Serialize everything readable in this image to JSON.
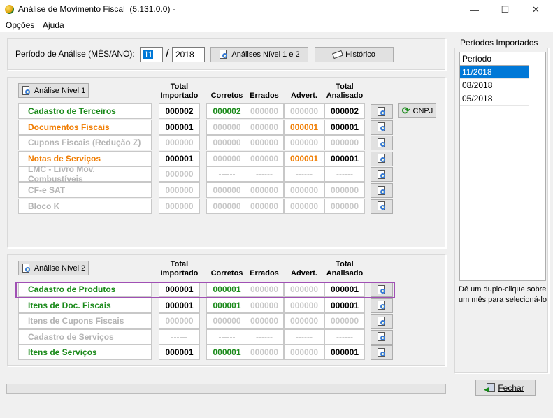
{
  "window": {
    "title": "Análise de Movimento Fiscal",
    "version": "(5.131.0.0) -",
    "minimize": "—",
    "maximize": "☐",
    "close": "✕"
  },
  "menu": {
    "opcoes": "Opções",
    "ajuda": "Ajuda"
  },
  "periodo": {
    "label": "Período de Análise (MÊS/ANO):",
    "month": "11",
    "separator": "/",
    "year": "2018",
    "btn_analises": "Análises Nível 1 e 2",
    "btn_historico": "Histórico"
  },
  "headers": {
    "total_importado_1": "Total",
    "total_importado_2": "Importado",
    "corretos": "Corretos",
    "errados": "Errados",
    "advert": "Advert.",
    "total_analisado_1": "Total",
    "total_analisado_2": "Analisado"
  },
  "nivel1": {
    "button": "Análise Nível 1",
    "cnpj_button": "CNPJ",
    "rows": [
      {
        "label": "Cadastro de Terceiros",
        "status": "green",
        "total": "000002",
        "corretos": "000002",
        "errados": "000000",
        "advert": "000000",
        "analisado": "000002"
      },
      {
        "label": "Documentos Fiscais",
        "status": "orange",
        "total": "000001",
        "corretos": "000000",
        "errados": "000000",
        "advert": "000001",
        "analisado": "000001"
      },
      {
        "label": "Cupons Fiscais (Redução Z)",
        "status": "gray",
        "total": "000000",
        "corretos": "000000",
        "errados": "000000",
        "advert": "000000",
        "analisado": "000000"
      },
      {
        "label": "Notas de Serviços",
        "status": "orange",
        "total": "000001",
        "corretos": "000000",
        "errados": "000000",
        "advert": "000001",
        "analisado": "000001"
      },
      {
        "label": "LMC - Livro Mov. Combustíveis",
        "status": "gray",
        "total": "000000",
        "corretos": "------",
        "errados": "------",
        "advert": "------",
        "analisado": "------"
      },
      {
        "label": "CF-e SAT",
        "status": "gray",
        "total": "000000",
        "corretos": "000000",
        "errados": "000000",
        "advert": "000000",
        "analisado": "000000"
      },
      {
        "label": "Bloco K",
        "status": "gray",
        "total": "000000",
        "corretos": "000000",
        "errados": "000000",
        "advert": "000000",
        "analisado": "000000"
      }
    ]
  },
  "nivel2": {
    "button": "Análise Nível 2",
    "rows": [
      {
        "label": "Cadastro de Produtos",
        "status": "green",
        "total": "000001",
        "corretos": "000001",
        "errados": "000000",
        "advert": "000000",
        "analisado": "000001"
      },
      {
        "label": "Itens de Doc. Fiscais",
        "status": "green",
        "total": "000001",
        "corretos": "000001",
        "errados": "000000",
        "advert": "000000",
        "analisado": "000001"
      },
      {
        "label": "Itens de Cupons Fiscais",
        "status": "gray",
        "total": "000000",
        "corretos": "000000",
        "errados": "000000",
        "advert": "000000",
        "analisado": "000000"
      },
      {
        "label": "Cadastro de Serviços",
        "status": "gray",
        "total": "------",
        "corretos": "------",
        "errados": "------",
        "advert": "------",
        "analisado": "------"
      },
      {
        "label": "Itens de Serviços",
        "status": "green",
        "total": "000001",
        "corretos": "000001",
        "errados": "000000",
        "advert": "000000",
        "analisado": "000001"
      }
    ]
  },
  "periodos": {
    "title": "Períodos Importados",
    "header": "Período",
    "items": [
      "11/2018",
      "08/2018",
      "05/2018"
    ],
    "selected": 0,
    "hint": "Dê um duplo-clique sobre um mês para selecioná-lo"
  },
  "footer": {
    "fechar": "Fechar"
  },
  "colors": {
    "green": "#1a8a1a",
    "orange": "#f07c00",
    "gray": "#b4b4b4",
    "selection": "#0078d7",
    "highlight": "#a050b4"
  }
}
